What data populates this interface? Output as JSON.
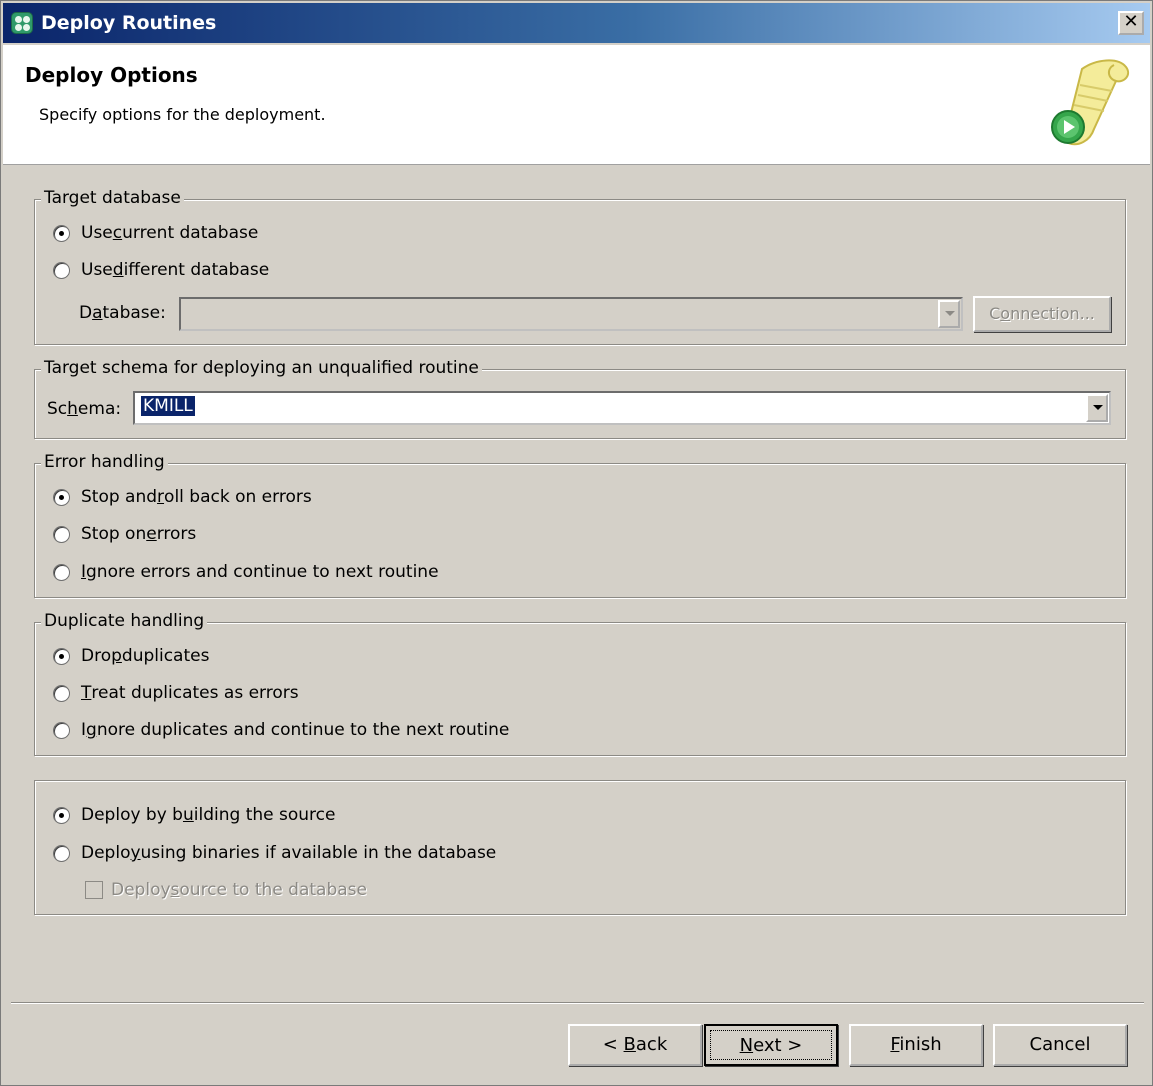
{
  "window": {
    "title": "Deploy Routines",
    "close_glyph": "✕"
  },
  "banner": {
    "title": "Deploy Options",
    "description": "Specify options for the deployment.",
    "icon": "scroll-play-icon"
  },
  "target_database": {
    "legend": "Target database",
    "use_current": {
      "pre": "Use ",
      "key": "c",
      "post": "urrent database",
      "selected": true
    },
    "use_different": {
      "pre": "Use ",
      "key": "d",
      "post": "ifferent database",
      "selected": false
    },
    "database_label": {
      "pre": "D",
      "key": "a",
      "post": "tabase:"
    },
    "database_value": "",
    "connection_button": {
      "pre": "C",
      "key": "o",
      "post": "nnection..."
    }
  },
  "target_schema": {
    "legend": "Target schema for deploying an unqualified routine",
    "schema_label": {
      "pre": "Sc",
      "key": "h",
      "post": "ema:"
    },
    "schema_value": "KMILL"
  },
  "error_handling": {
    "legend": "Error handling",
    "stop_rollback": {
      "pre": "Stop and ",
      "key": "r",
      "post": "oll back on errors",
      "selected": true
    },
    "stop_on_errors": {
      "pre": "Stop on ",
      "key": "e",
      "post": "rrors",
      "selected": false
    },
    "ignore_errors": {
      "pre": "",
      "key": "I",
      "post": "gnore errors and continue to next routine",
      "selected": false
    }
  },
  "duplicate_handling": {
    "legend": "Duplicate handling",
    "drop_duplicates": {
      "pre": "Dro",
      "key": "p",
      "post": " duplicates",
      "selected": true
    },
    "treat_as_errors": {
      "pre": "",
      "key": "T",
      "post": "reat duplicates as errors",
      "selected": false
    },
    "ignore_duplicates": {
      "pre": "I",
      "key": "g",
      "post": "nore duplicates and continue to the next routine",
      "selected": false
    }
  },
  "build_options": {
    "deploy_building": {
      "pre": "Deploy by b",
      "key": "u",
      "post": "ilding the source",
      "selected": true
    },
    "deploy_binaries": {
      "pre": "Deplo",
      "key": "y",
      "post": " using binaries if available in the database",
      "selected": false
    },
    "deploy_source": {
      "pre": "Deploy ",
      "key": "s",
      "post": "ource to the database",
      "checked": false,
      "enabled": false
    }
  },
  "buttons": {
    "back": {
      "pre": "< ",
      "key": "B",
      "post": "ack"
    },
    "next": {
      "pre": "",
      "key": "N",
      "post": "ext >"
    },
    "finish": {
      "pre": "",
      "key": "F",
      "post": "inish"
    },
    "cancel": "Cancel"
  }
}
